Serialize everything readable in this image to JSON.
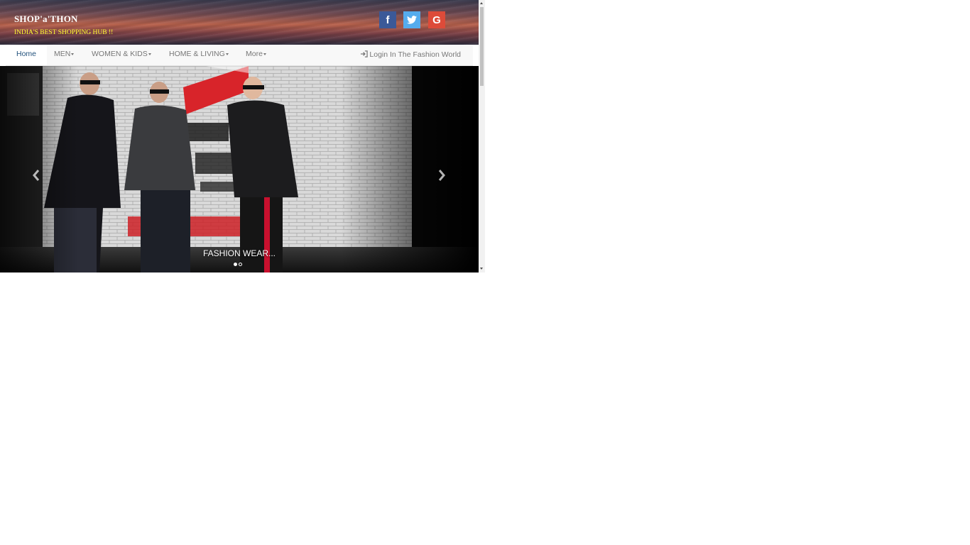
{
  "header": {
    "brand_title": "SHOP'a'THON",
    "brand_tagline": "INDIA'S BEST SHOPPING HUB !!",
    "social": [
      {
        "name": "facebook",
        "glyph": "f",
        "color": "#3b5998"
      },
      {
        "name": "twitter",
        "glyph": "twitter-bird",
        "color": "#55acee"
      },
      {
        "name": "google",
        "glyph": "G",
        "color": "#dd4b39"
      }
    ]
  },
  "navbar": {
    "items": [
      {
        "label": "Home",
        "active": true
      },
      {
        "label": "MEN",
        "dropdown": true
      },
      {
        "label": "WOMEN & KIDS",
        "dropdown": true
      },
      {
        "label": "HOME & LIVING",
        "dropdown": true
      },
      {
        "label": "More",
        "dropdown": true
      }
    ],
    "login_label": "Login In The Fashion World",
    "login_icon": "sign-in-icon"
  },
  "carousel": {
    "caption": "FASHION WEAR...",
    "slide_count": 2,
    "active_slide": 1,
    "controls": [
      "chevron-left-icon",
      "chevron-right-icon"
    ]
  }
}
